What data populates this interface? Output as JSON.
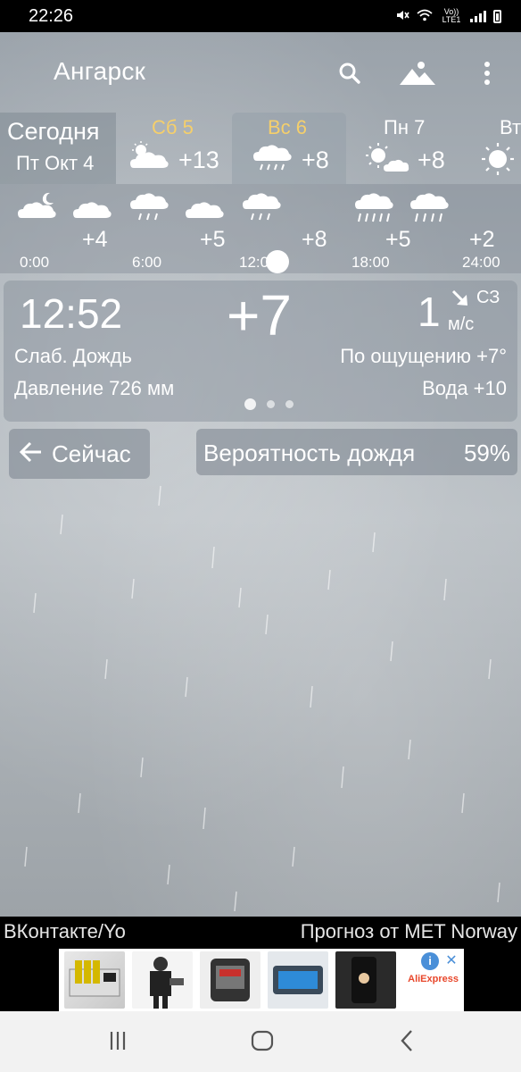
{
  "status_bar": {
    "time": "22:26",
    "network": "Vo)) LTE1"
  },
  "topbar": {
    "city": "Ангарск",
    "search_icon": "search-icon",
    "landscape_icon": "landscape-icon",
    "menu_icon": "more-vert-icon"
  },
  "days": {
    "today": {
      "title": "Сегодня",
      "date": "Пт Окт 4"
    },
    "items": [
      {
        "name": "Сб 5",
        "temp": "+13",
        "icon": "cloud-sun-icon",
        "name_color": "#f5cf6b"
      },
      {
        "name": "Вс 6",
        "temp": "+8",
        "icon": "rain-cloud-icon",
        "name_color": "#f5cf6b"
      },
      {
        "name": "Пн 7",
        "temp": "+8",
        "icon": "sun-cloud-icon",
        "name_color": "#ffffff"
      },
      {
        "name": "Вт",
        "temp": "",
        "icon": "sun-icon",
        "name_color": "#ffffff"
      }
    ]
  },
  "hourly": {
    "temps": [
      "+4",
      "+5",
      "+8",
      "+5",
      "+2"
    ],
    "times": [
      "0:00",
      "6:00",
      "12:00",
      "18:00",
      "24:00"
    ]
  },
  "current": {
    "time": "12:52",
    "temp": "+7",
    "wind_speed": "1",
    "wind_dir": "СЗ",
    "wind_unit": "м/с",
    "condition": "Слаб. Дождь",
    "feels_like": "По ощущению +7°",
    "pressure": "Давление 726 мм",
    "water": "Вода +10"
  },
  "buttons": {
    "now_label": "Сейчас",
    "rain_prob_label": "Вероятность дождя",
    "rain_prob_value": "59%"
  },
  "credits": {
    "left": "ВКонтакте/Yo",
    "right": "Прогноз от MET Norway"
  },
  "ad": {
    "brand": "AliExpress",
    "info": "i",
    "close": "✕"
  },
  "colors": {
    "accent_day": "#f5cf6b",
    "panel": "#828c96"
  }
}
